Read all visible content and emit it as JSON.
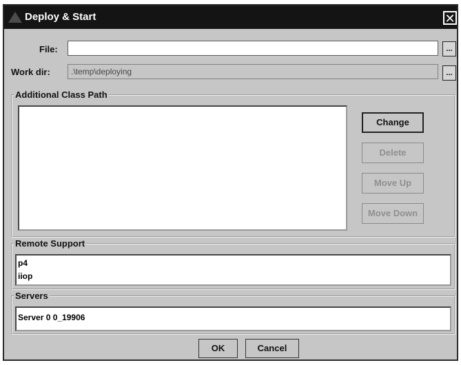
{
  "window": {
    "title": "Deploy & Start",
    "close_glyph": "✕"
  },
  "file": {
    "label": "File:",
    "value": "",
    "browse_label": "..."
  },
  "workdir": {
    "label": "Work dir:",
    "value": ".\\temp\\deploying",
    "browse_label": "..."
  },
  "classpath": {
    "legend": "Additional Class Path",
    "items": [],
    "buttons": {
      "change": "Change",
      "delete": "Delete",
      "move_up": "Move Up",
      "move_down": "Move Down"
    }
  },
  "remote": {
    "legend": "Remote Support",
    "items": [
      "p4",
      "iiop"
    ]
  },
  "servers": {
    "legend": "Servers",
    "items": [
      "Server 0 0_19906"
    ]
  },
  "footer": {
    "ok": "OK",
    "cancel": "Cancel"
  }
}
